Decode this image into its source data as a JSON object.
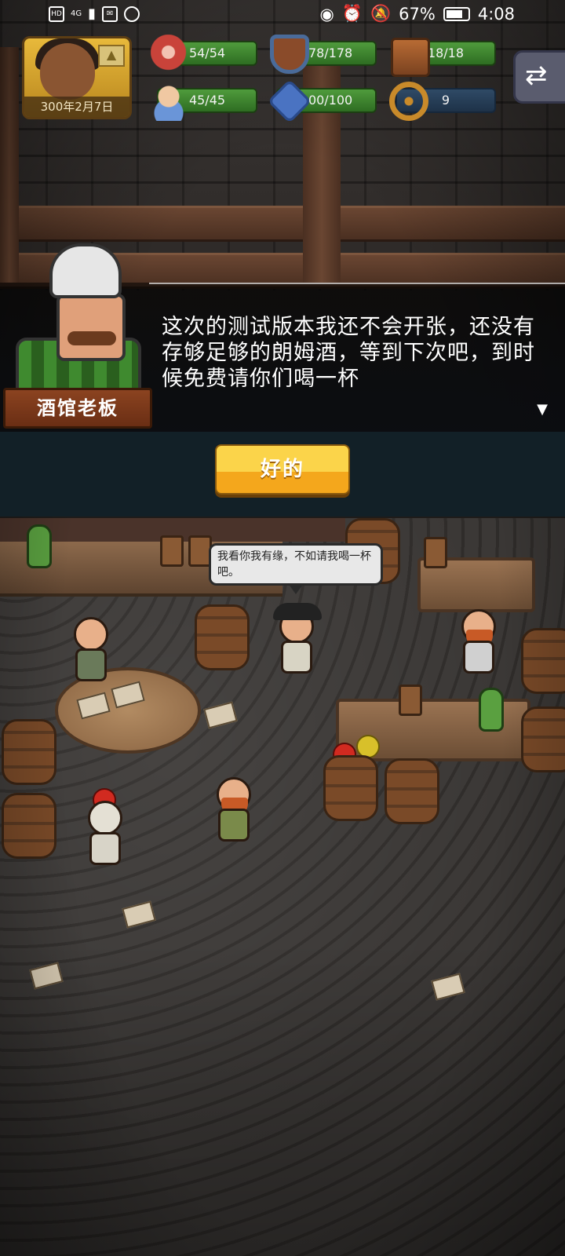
{
  "status_bar": {
    "network_label": "HD",
    "signal_label": "4G",
    "battery_percent": "67%",
    "time": "4:08"
  },
  "hud": {
    "date": "300年2月7日",
    "stats": [
      {
        "icon": "meat-icon",
        "value": "54/54"
      },
      {
        "icon": "shield-icon",
        "value": "178/178"
      },
      {
        "icon": "wood-icon",
        "value": "18/18"
      },
      {
        "icon": "sailor-icon",
        "value": "45/45"
      },
      {
        "icon": "fist-icon",
        "value": "100/100"
      },
      {
        "icon": "ship-wheel-icon",
        "value": "9"
      }
    ],
    "swap_symbol": "⇄"
  },
  "dialog": {
    "speaker": "酒馆老板",
    "text": "这次的测试版本我还不会开张，还没有存够足够的朗姆酒，等到下次吧，到时候免费请你们喝一杯",
    "continue_symbol": "▼",
    "ok_label": "好的"
  },
  "scene": {
    "speech_bubble": "我看你我有缘，不如请我喝一杯吧。"
  },
  "colors": {
    "stat_green": "#4f9b3c",
    "stat_blue": "#2f4a66",
    "ok_button": "#fbd44a",
    "name_plate": "#8b4320"
  }
}
